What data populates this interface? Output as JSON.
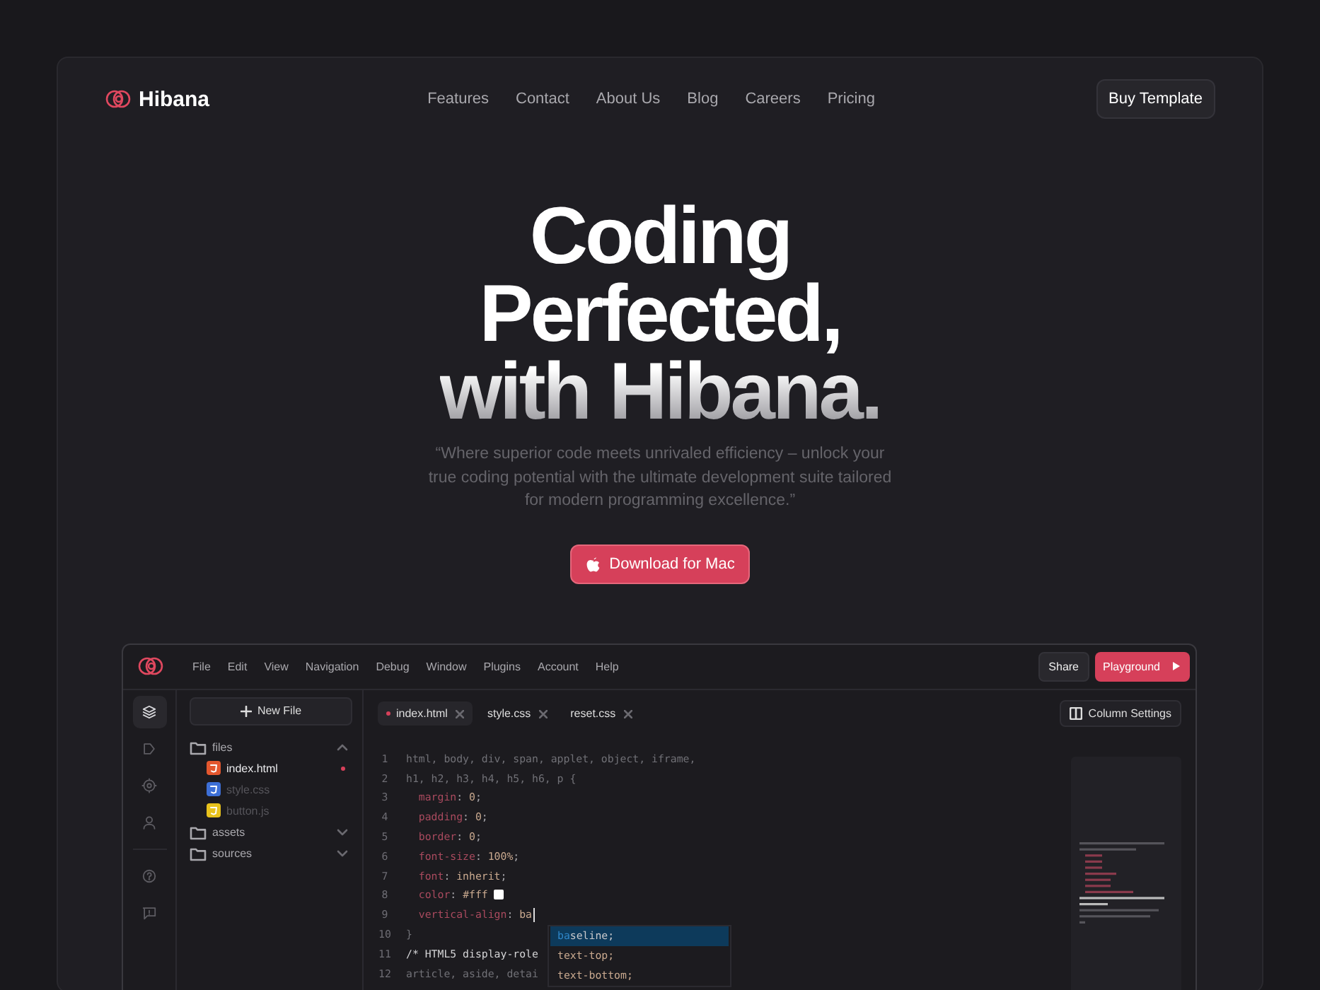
{
  "nav": {
    "brand": "Hibana",
    "links": [
      "Features",
      "Contact",
      "About Us",
      "Blog",
      "Careers",
      "Pricing"
    ],
    "cta": "Buy Template"
  },
  "hero": {
    "title_lines": [
      "Coding",
      "Perfected,",
      "with Hibana."
    ],
    "quote": "“Where superior code meets unrivaled efficiency – unlock your true coding potential with the ultimate development suite tailored for modern programming excellence.”",
    "button": "Download for Mac"
  },
  "editor": {
    "menu": [
      "File",
      "Edit",
      "View",
      "Navigation",
      "Debug",
      "Window",
      "Plugins",
      "Account",
      "Help"
    ],
    "share": "Share",
    "playground": "Playground",
    "rail": [
      {
        "selected": true
      },
      {
        "selected": false
      },
      {
        "selected": false
      },
      {
        "selected": false
      },
      {
        "selected": false
      },
      {
        "selected": false
      }
    ],
    "new_file": "New File",
    "tree": [
      {
        "name": "files",
        "expanded": true,
        "children": [
          {
            "name": "index.html",
            "kind": "html",
            "selected": true,
            "modified": true
          },
          {
            "name": "style.css",
            "kind": "css",
            "selected": false,
            "modified": false
          },
          {
            "name": "button.js",
            "kind": "js",
            "selected": false,
            "modified": false
          }
        ]
      },
      {
        "name": "assets",
        "expanded": false
      },
      {
        "name": "sources",
        "expanded": false
      }
    ],
    "tabs": [
      {
        "label": "index.html",
        "selected": true,
        "modified": true
      },
      {
        "label": "style.css",
        "selected": false,
        "modified": false
      },
      {
        "label": "reset.css",
        "selected": false,
        "modified": false
      }
    ],
    "column_settings": "Column Settings",
    "code": [
      {
        "number": "1",
        "segments": [
          {
            "kind": "plain",
            "text": "html, body, div, span, applet, object, iframe,"
          }
        ]
      },
      {
        "number": "2",
        "segments": [
          {
            "kind": "plain",
            "text": "h1, h2, h3, h4, h5, h6, p {"
          }
        ]
      },
      {
        "number": "3",
        "segments": [
          {
            "kind": "prop",
            "text": "  margin"
          },
          {
            "kind": "punct",
            "text": ": "
          },
          {
            "kind": "value",
            "text": "0"
          },
          {
            "kind": "punct",
            "text": ";"
          }
        ]
      },
      {
        "number": "4",
        "segments": [
          {
            "kind": "prop",
            "text": "  padding"
          },
          {
            "kind": "punct",
            "text": ": "
          },
          {
            "kind": "value",
            "text": "0"
          },
          {
            "kind": "punct",
            "text": ";"
          }
        ]
      },
      {
        "number": "5",
        "segments": [
          {
            "kind": "prop",
            "text": "  border"
          },
          {
            "kind": "punct",
            "text": ": "
          },
          {
            "kind": "value",
            "text": "0"
          },
          {
            "kind": "punct",
            "text": ";"
          }
        ]
      },
      {
        "number": "6",
        "segments": [
          {
            "kind": "prop",
            "text": "  font-size"
          },
          {
            "kind": "punct",
            "text": ": "
          },
          {
            "kind": "value",
            "text": "100%"
          },
          {
            "kind": "punct",
            "text": ";"
          }
        ]
      },
      {
        "number": "7",
        "segments": [
          {
            "kind": "prop",
            "text": "  font"
          },
          {
            "kind": "punct",
            "text": ": "
          },
          {
            "kind": "value",
            "text": "inherit"
          },
          {
            "kind": "punct",
            "text": ";"
          }
        ]
      },
      {
        "number": "8",
        "segments": [
          {
            "kind": "prop",
            "text": "  color"
          },
          {
            "kind": "punct",
            "text": ": "
          },
          {
            "kind": "value",
            "text": "#fff"
          },
          {
            "kind": "swatch"
          }
        ]
      },
      {
        "number": "9",
        "cursor": true,
        "segments": [
          {
            "kind": "prop",
            "text": "  vertical-align"
          },
          {
            "kind": "punct",
            "text": ": "
          },
          {
            "kind": "value",
            "text": "ba"
          }
        ]
      },
      {
        "number": "10",
        "segments": [
          {
            "kind": "plain",
            "text": "}"
          }
        ]
      },
      {
        "number": "11",
        "segments": [
          {
            "kind": "comment",
            "text": "/* HTML5 display-role"
          }
        ]
      },
      {
        "number": "12",
        "segments": [
          {
            "kind": "plain",
            "text": "article, aside, detai"
          }
        ]
      }
    ],
    "suggestions": [
      {
        "match": "ba",
        "text": "seline;",
        "selected": true
      },
      {
        "text": "text-top;",
        "selected": false
      },
      {
        "text": "text-bottom;",
        "selected": false
      }
    ]
  }
}
